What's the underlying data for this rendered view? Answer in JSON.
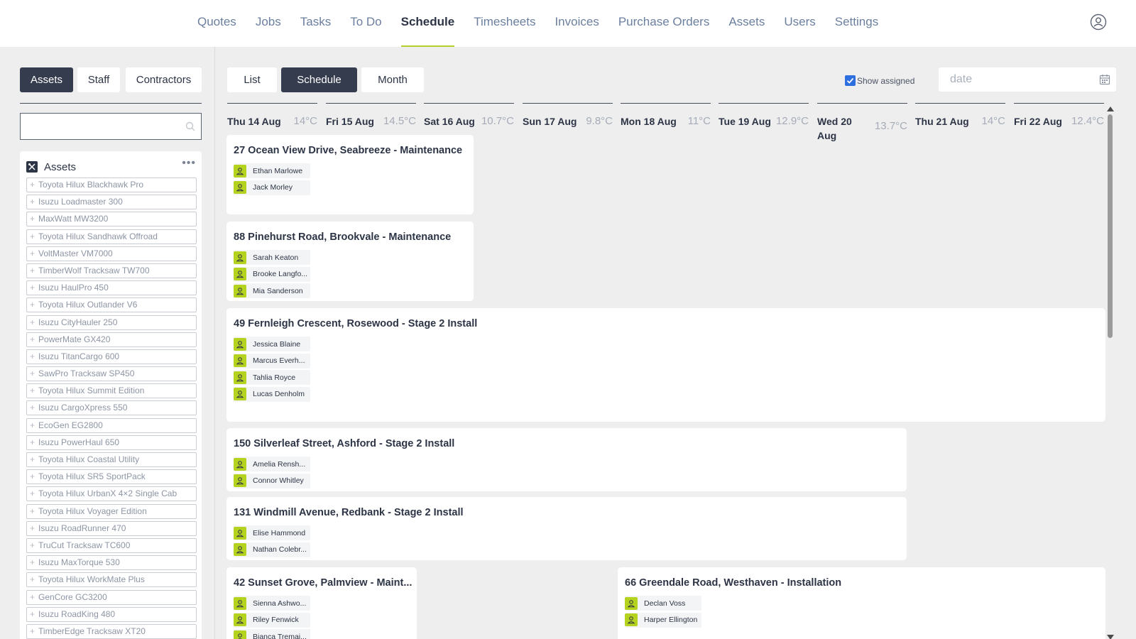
{
  "nav": {
    "items": [
      "Quotes",
      "Jobs",
      "Tasks",
      "To Do",
      "Schedule",
      "Timesheets",
      "Invoices",
      "Purchase Orders",
      "Assets",
      "Users",
      "Settings"
    ],
    "active": "Schedule"
  },
  "resource_tabs": [
    "Assets",
    "Staff",
    "Contractors"
  ],
  "view_tabs": [
    "List",
    "Schedule",
    "Month"
  ],
  "show_assigned": {
    "label": "Show assigned",
    "checked": true
  },
  "date_input": {
    "placeholder": "date"
  },
  "search": {
    "placeholder": "",
    "value": ""
  },
  "assets_panel": {
    "title": "Assets",
    "items": [
      "Toyota Hilux Blackhawk Pro",
      "Isuzu Loadmaster 300",
      "MaxWatt MW3200",
      "Toyota Hilux Sandhawk Offroad",
      "VoltMaster VM7000",
      "TimberWolf Tracksaw TW700",
      "Isuzu HaulPro 450",
      "Toyota Hilux Outlander V6",
      "Isuzu CityHauler 250",
      "PowerMate GX420",
      "Isuzu TitanCargo 600",
      "SawPro Tracksaw SP450",
      "Toyota Hilux Summit Edition",
      "Isuzu CargoXpress 550",
      "EcoGen EG2800",
      "Isuzu PowerHaul 650",
      "Toyota Hilux Coastal Utility",
      "Toyota Hilux SR5 SportPack",
      "Toyota Hilux UrbanX 4×2 Single Cab",
      "Toyota Hilux Voyager Edition",
      "Isuzu RoadRunner 470",
      "TruCut Tracksaw TC600",
      "Isuzu MaxTorque 530",
      "Toyota Hilux WorkMate Plus",
      "GenCore GC3200",
      "Isuzu RoadKing 480",
      "TimberEdge Tracksaw XT20"
    ]
  },
  "days": [
    {
      "label": "Thu 14 Aug",
      "temp": "14°C"
    },
    {
      "label": "Fri 15 Aug",
      "temp": "14.5°C"
    },
    {
      "label": "Sat 16 Aug",
      "temp": "10.7°C"
    },
    {
      "label": "Sun 17 Aug",
      "temp": "9.8°C"
    },
    {
      "label": "Mon 18 Aug",
      "temp": "11°C"
    },
    {
      "label": "Tue 19 Aug",
      "temp": "12.9°C"
    },
    {
      "label": "Wed 20 Aug",
      "temp": "13.7°C"
    },
    {
      "label": "Thu 21 Aug",
      "temp": "14°C"
    },
    {
      "label": "Fri 22 Aug",
      "temp": "12.4°C"
    }
  ],
  "jobs": [
    {
      "title": "27 Ocean View Drive, Seabreeze - Maintenance",
      "people": [
        "Ethan Marlowe",
        "Jack Morley"
      ]
    },
    {
      "title": "88 Pinehurst Road, Brookvale - Maintenance",
      "people": [
        "Sarah Keaton",
        "Brooke Langfo...",
        "Mia Sanderson"
      ]
    },
    {
      "title": "49 Fernleigh Crescent, Rosewood - Stage 2 Install",
      "people": [
        "Jessica Blaine",
        "Marcus Everh...",
        "Tahlia Royce",
        "Lucas Denholm"
      ]
    },
    {
      "title": "150 Silverleaf Street, Ashford - Stage 2 Install",
      "people": [
        "Amelia Rensh...",
        "Connor Whitley"
      ]
    },
    {
      "title": "131 Windmill Avenue, Redbank - Stage 2 Install",
      "people": [
        "Elise Hammond",
        "Nathan Colebr..."
      ]
    },
    {
      "title": "42 Sunset Grove, Palmview - Maint...",
      "people": [
        "Sienna Ashwo...",
        "Riley Fenwick",
        "Bianca Tremai..."
      ]
    },
    {
      "title": "66 Greendale Road, Westhaven - Installation",
      "people": [
        "Declan Voss",
        "Harper Ellington"
      ]
    }
  ],
  "colors": {
    "accent": "#b5d21e",
    "active_tab_bg": "#343c4e",
    "page_bg": "#eeeeee",
    "checkbox": "#2e6fe0"
  }
}
